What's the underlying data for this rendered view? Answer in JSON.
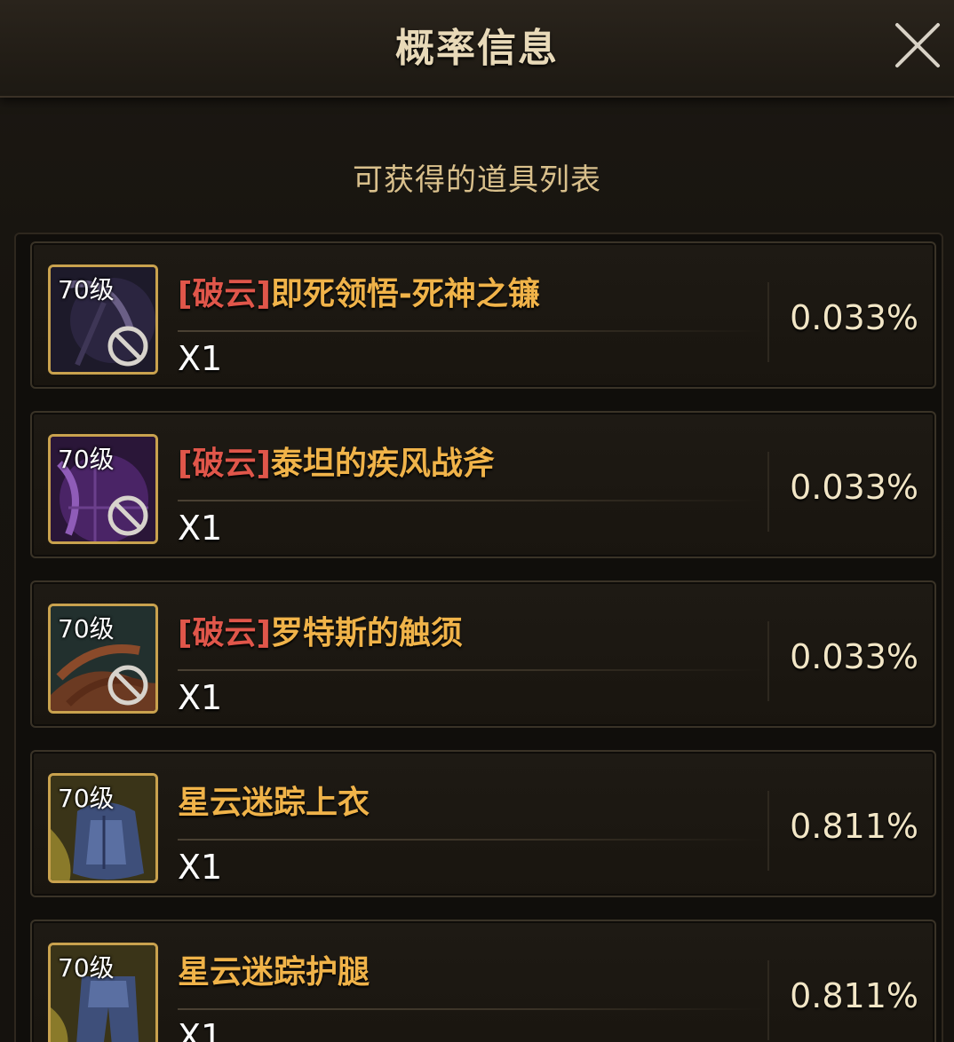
{
  "dialog": {
    "title": "概率信息",
    "subtitle": "可获得的道具列表"
  },
  "items": [
    {
      "level": "70级",
      "prefix": "[破云]",
      "name": "即死领悟-死神之镰",
      "qty": "X1",
      "prob": "0.033%",
      "banned": true,
      "art": "scythe"
    },
    {
      "level": "70级",
      "prefix": "[破云]",
      "name": "泰坦的疾风战斧",
      "qty": "X1",
      "prob": "0.033%",
      "banned": true,
      "art": "axe"
    },
    {
      "level": "70级",
      "prefix": "[破云]",
      "name": "罗特斯的触须",
      "qty": "X1",
      "prob": "0.033%",
      "banned": true,
      "art": "tentacle"
    },
    {
      "level": "70级",
      "prefix": "",
      "name": "星云迷踪上衣",
      "qty": "X1",
      "prob": "0.811%",
      "banned": false,
      "art": "armor"
    },
    {
      "level": "70级",
      "prefix": "",
      "name": "星云迷踪护腿",
      "qty": "X1",
      "prob": "0.811%",
      "banned": false,
      "art": "legs"
    }
  ],
  "colors": {
    "accent": "#f0b349",
    "prefix": "#e0564a",
    "frame_gold": "#c9a24e"
  }
}
